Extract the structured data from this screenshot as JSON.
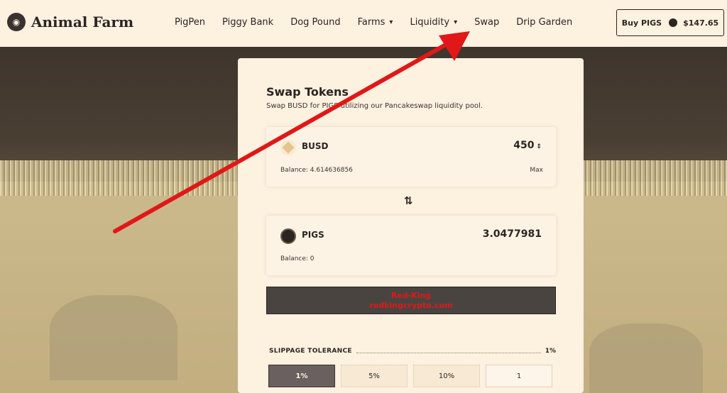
{
  "brand": {
    "name": "Animal Farm",
    "icon": "pig-logo-icon"
  },
  "nav": {
    "items": [
      {
        "label": "PigPen",
        "dropdown": false
      },
      {
        "label": "Piggy Bank",
        "dropdown": false
      },
      {
        "label": "Dog Pound",
        "dropdown": false
      },
      {
        "label": "Farms",
        "dropdown": true
      },
      {
        "label": "Liquidity",
        "dropdown": true
      },
      {
        "label": "Swap",
        "dropdown": false
      },
      {
        "label": "Drip Garden",
        "dropdown": false
      }
    ]
  },
  "buy": {
    "label": "Buy PIGS",
    "price": "$147.65",
    "icon": "pigs-coin-icon"
  },
  "swap": {
    "title": "Swap Tokens",
    "subtitle": "Swap BUSD for PIGS utilizing our Pancakeswap liquidity pool.",
    "from": {
      "token": "BUSD",
      "amount": "450",
      "balance_label": "Balance: 4.614636856",
      "max_label": "Max",
      "icon": "busd-token-icon"
    },
    "to": {
      "token": "PIGS",
      "amount": "3.0477981",
      "balance_label": "Balance: 0",
      "icon": "pigs-token-icon"
    },
    "switch_icon": "swap-arrows-icon",
    "watermark": {
      "line1": "Red-King",
      "line2": "redkingcrypto.com"
    },
    "slippage": {
      "label": "SLIPPAGE TOLERANCE",
      "value": "1%",
      "options": [
        "1%",
        "5%",
        "10%"
      ],
      "custom_value": "1",
      "selected": "1%"
    }
  },
  "colors": {
    "accent_dark": "#2b2522",
    "cream": "#fdf1e0",
    "annotation_red": "#e01818"
  }
}
